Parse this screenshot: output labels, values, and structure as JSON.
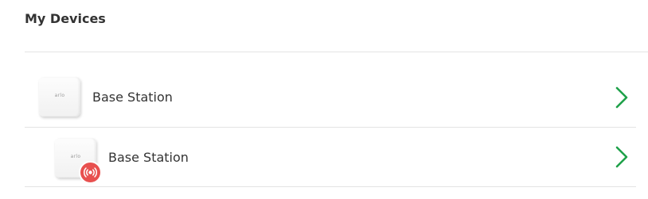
{
  "section": {
    "title": "My Devices"
  },
  "devices": [
    {
      "name": "Base Station",
      "brand": "arlo",
      "icon": "base-station-icon",
      "alert": false
    },
    {
      "name": "Base Station",
      "brand": "arlo",
      "icon": "base-station-icon",
      "alert": true,
      "alert_icon": "siren-alert-icon"
    }
  ],
  "colors": {
    "chevron": "#1fa14a",
    "alert": "#e8504f",
    "text": "#333333",
    "divider": "#e3e3e3"
  }
}
